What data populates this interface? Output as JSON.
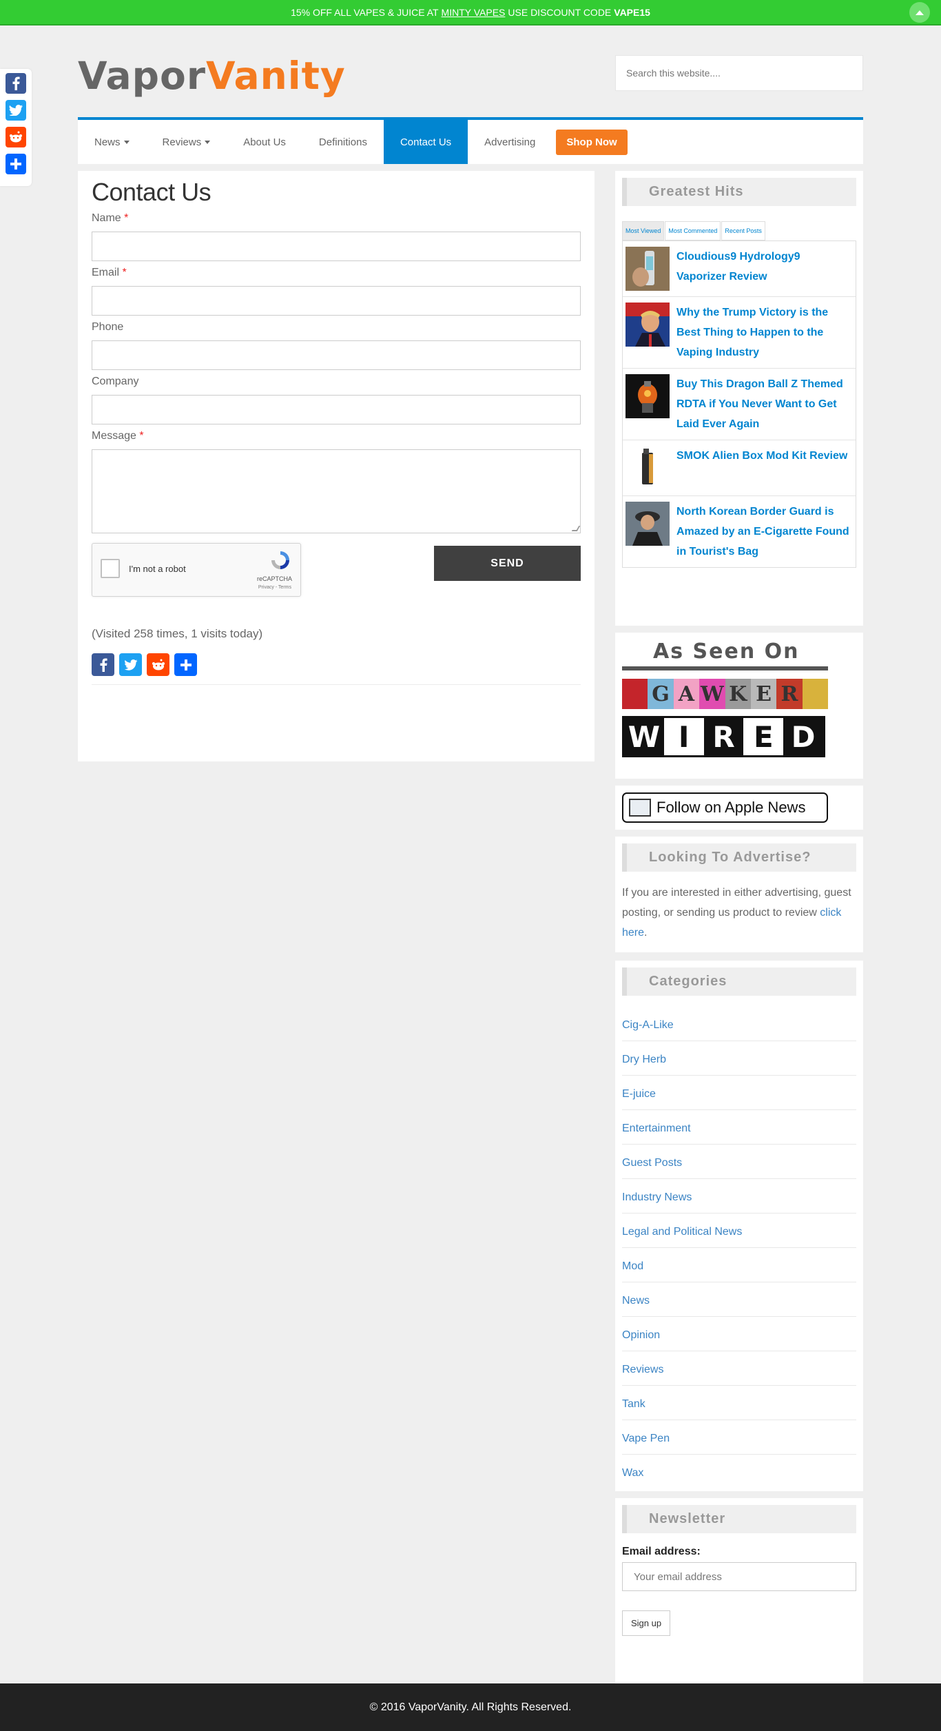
{
  "promo": {
    "text_before": "15% OFF ALL VAPES & JUICE AT",
    "link": "MINTY VAPES",
    "text_after": "USE DISCOUNT CODE",
    "code": "VAPE15"
  },
  "logo": {
    "part1": "Vapor",
    "part2": "Vanity"
  },
  "search": {
    "placeholder": "Search this website...."
  },
  "nav": {
    "items": [
      {
        "label": "News"
      },
      {
        "label": "Reviews"
      },
      {
        "label": "About Us"
      },
      {
        "label": "Definitions"
      },
      {
        "label": "Contact Us"
      },
      {
        "label": "Advertising"
      }
    ],
    "shop": "Shop Now"
  },
  "contact": {
    "title": "Contact Us",
    "fields": {
      "name": "Name",
      "email": "Email",
      "phone": "Phone",
      "company": "Company",
      "message": "Message"
    },
    "required_mark": "*",
    "captcha_label": "I'm not a robot",
    "captcha_brand": "reCAPTCHA",
    "captcha_terms": "Privacy - Terms",
    "send": "SEND",
    "visited": "(Visited 258 times, 1 visits today)"
  },
  "greatest_hits": {
    "title": "Greatest Hits",
    "tabs": [
      "Most Viewed",
      "Most Commented",
      "Recent Posts"
    ],
    "posts": [
      "Cloudious9 Hydrology9 Vaporizer Review",
      "Why the Trump Victory is the Best Thing to Happen to the Vaping Industry",
      "Buy This Dragon Ball Z Themed RDTA if You Never Want to Get Laid Ever Again",
      "SMOK Alien Box Mod Kit Review",
      "North Korean Border Guard is Amazed by an E-Cigarette Found in Tourist's Bag"
    ]
  },
  "as_seen_on": {
    "title": "As Seen On",
    "gawker_letters": [
      "G",
      "A",
      "W",
      "K",
      "E",
      "R"
    ],
    "wired_letters": [
      "W",
      "I",
      "R",
      "E",
      "D"
    ]
  },
  "apple_news": "Follow on Apple News",
  "advertise": {
    "title": "Looking To Advertise?",
    "text": "If you are interested in either advertising, guest posting, or sending us product to review",
    "link": "click here",
    "end": "."
  },
  "categories": {
    "title": "Categories",
    "items": [
      "Cig-A-Like",
      "Dry Herb",
      "E-juice",
      "Entertainment",
      "Guest Posts",
      "Industry News",
      "Legal and Political News",
      "Mod",
      "News",
      "Opinion",
      "Reviews",
      "Tank",
      "Vape Pen",
      "Wax"
    ]
  },
  "newsletter": {
    "title": "Newsletter",
    "label": "Email address:",
    "placeholder": "Your email address",
    "button": "Sign up"
  },
  "footer": "© 2016 VaporVanity. All Rights Reserved.",
  "colors": {
    "promo": "#33cc33",
    "accent_blue": "#0185d0",
    "shop_orange": "#f47b20",
    "footer": "#222222"
  }
}
